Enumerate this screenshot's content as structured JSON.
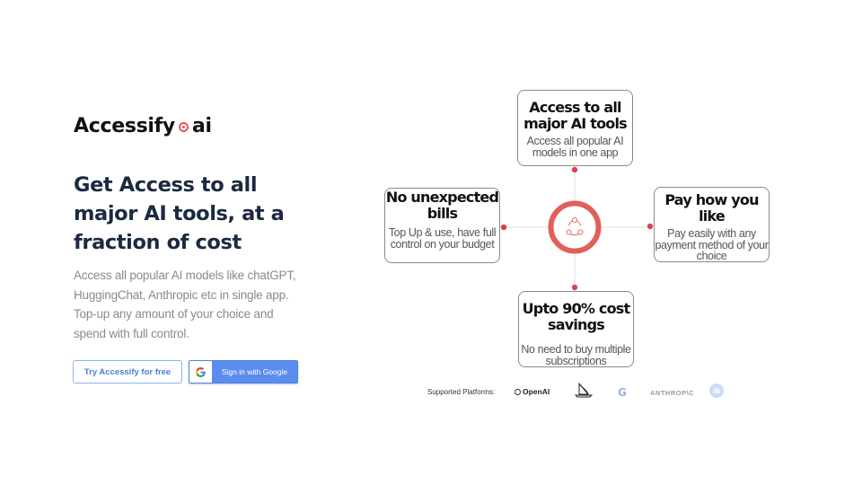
{
  "brand": {
    "name_left": "Accessify",
    "name_right": "ai",
    "accent_color": "#e05a5a"
  },
  "hero": {
    "headline": "Get Access to all major AI tools, at a fraction of cost",
    "description": "Access all popular AI models like chatGPT, HuggingChat, Anthropic etc in single app. Top-up any amount of your choice and spend with full control."
  },
  "actions": {
    "try_label": "Try Accessify for free",
    "google_label": "Sign in with Google",
    "google_icon": "google-g-icon"
  },
  "features": {
    "center_icon": "share-network-icon",
    "top": {
      "title": "Access to all major AI tools",
      "desc": "Access all popular AI models in one app"
    },
    "left": {
      "title": "No unexpected bills",
      "desc": "Top Up & use, have full control on your budget"
    },
    "right": {
      "title": "Pay how you like",
      "desc": "Pay easily with any payment method of your choice"
    },
    "bottom": {
      "title": "Upto 90% cost savings",
      "desc": "No need to buy multiple subscriptions"
    }
  },
  "platforms": {
    "label": "Supported Platforms:",
    "items": [
      {
        "name": "OpenAI",
        "icon": "openai-logo"
      },
      {
        "name": "Midjourney",
        "icon": "midjourney-boat-logo"
      },
      {
        "name": "G",
        "icon": "google-logo"
      },
      {
        "name": "ANTHROP\\C",
        "icon": "anthropic-logo"
      },
      {
        "name": "HuggingChat",
        "icon": "huggingchat-logo"
      }
    ]
  }
}
